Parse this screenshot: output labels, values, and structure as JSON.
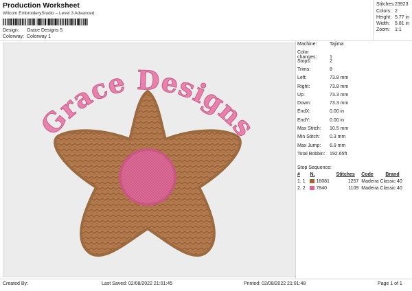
{
  "header": {
    "title": "Production Worksheet",
    "subtitle": "Wilcom EmbroideryStudio – Level 3 Advanced",
    "design_label": "Design:",
    "design_value": "Grace Designs 5",
    "colorway_label": "Colorway:",
    "colorway_value": "Colorway 1"
  },
  "stats": [
    {
      "label": "Stitches:",
      "value": "23923"
    },
    {
      "label": "Colors:",
      "value": "2"
    },
    {
      "label": "Height:",
      "value": "5.77 in"
    },
    {
      "label": "Width:",
      "value": "5.81 in"
    },
    {
      "label": "Zoom:",
      "value": "1:1"
    }
  ],
  "design": {
    "text": "Grace Designs",
    "text_color": "#e882ad",
    "flower_color": "#b57b4e",
    "center_color": "#de6d97",
    "background": "#ececec"
  },
  "machine": [
    {
      "label": "Machine:",
      "value": "Tajima"
    },
    {
      "label": "Color changes:",
      "value": "1"
    },
    {
      "label": "Stops:",
      "value": "2"
    },
    {
      "label": "Trims:",
      "value": "8"
    },
    {
      "label": "Left:",
      "value": "73.8 mm"
    },
    {
      "label": "Right:",
      "value": "73.8 mm"
    },
    {
      "label": "Up:",
      "value": "73.3 mm"
    },
    {
      "label": "Down:",
      "value": "73.3 mm"
    },
    {
      "label": "EndX:",
      "value": "0.00 in"
    },
    {
      "label": "EndY:",
      "value": "0.00 in"
    },
    {
      "label": "Max Stitch:",
      "value": "10.5 mm"
    },
    {
      "label": "Min Stitch:",
      "value": "0.3 mm"
    },
    {
      "label": "Max Jump:",
      "value": "6.9 mm"
    },
    {
      "label": "Total Bobbin:",
      "value": "192.65ft"
    }
  ],
  "stop_sequence": {
    "title": "Stop Sequence:",
    "headers": [
      "#",
      "N.",
      "Stitches",
      "Code",
      "Brand"
    ],
    "rows": [
      {
        "num": "1.",
        "n": "1",
        "color": "#a8602f",
        "code_col": "16081",
        "stitches": "1257",
        "brand": "Madeira Classic 40"
      },
      {
        "num": "2.",
        "n": "2",
        "color": "#e1628e",
        "code_col": "7840",
        "stitches": "1109",
        "brand": "Madeira Classic 40"
      }
    ]
  },
  "footer": {
    "created_by": "Created By:",
    "last_saved": "Last Saved: 02/08/2022 21:01:45",
    "printed": "Printed: 02/08/2022 21:01:48",
    "page": "Page 1 of 1"
  }
}
